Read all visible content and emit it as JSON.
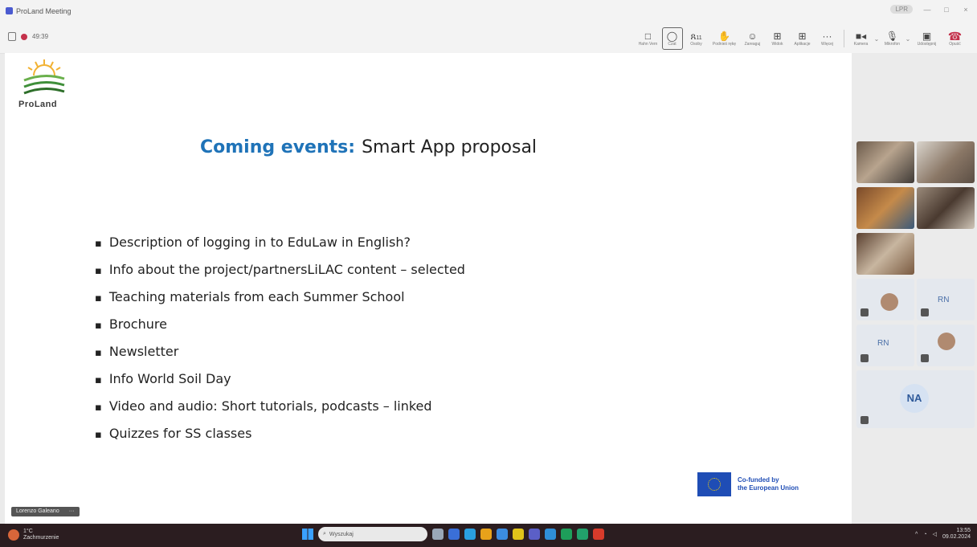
{
  "window": {
    "title": "ProLand Meeting",
    "controls": {
      "pill": "LPR",
      "minimize": "—",
      "maximize": "□",
      "close": "×"
    }
  },
  "meeting": {
    "timer": "49:39"
  },
  "toolbar": {
    "items": [
      {
        "name": "raise-item",
        "icon": "□",
        "label": "Hahn Vern"
      },
      {
        "name": "chat",
        "icon": "◯",
        "label": "Czat"
      },
      {
        "name": "people",
        "icon": "ጸ",
        "label": "Osoby"
      },
      {
        "name": "raise-hand",
        "icon": "✋",
        "label": "Podnieś rękę"
      },
      {
        "name": "react",
        "icon": "☺",
        "label": "Zareaguj"
      },
      {
        "name": "view",
        "icon": "⊞",
        "label": "Widok"
      },
      {
        "name": "apps",
        "icon": "⊞",
        "label": "Aplikacje"
      },
      {
        "name": "more",
        "icon": "···",
        "label": "Więcej"
      }
    ],
    "people_count": "11",
    "camera_label": "Kamera",
    "mic_label": "Mikrofon",
    "share_label": "Udostępnij",
    "leave_label": "Opuść"
  },
  "slide": {
    "logo_text": "ProLand",
    "title_highlight": "Coming events:",
    "title_rest": "Smart App proposal",
    "bullets": [
      "Description of logging in to EduLaw in English?",
      "Info about the project/partnersLiLAC content – selected",
      "Teaching materials from each Summer School",
      "Brochure",
      "Newsletter",
      "Info World Soil Day",
      "Video and audio: Short tutorials, podcasts – linked",
      "Quizzes for SS classes"
    ],
    "eu_line1": "Co-funded by",
    "eu_line2": "the European Union"
  },
  "presenter": {
    "name": "Lorenzo Galeano",
    "more": "···"
  },
  "participants": {
    "rn1": "RN",
    "rn2": "RN",
    "na": "NA"
  },
  "taskbar": {
    "weather_temp": "1°C",
    "weather_desc": "Zachmurzenie",
    "search_placeholder": "Wyszukaj",
    "time": "13:55",
    "date": "09.02.2024",
    "tray_chevron": "^"
  },
  "colors": {
    "accent_blue": "#1f73b8",
    "leave_red": "#c4314b",
    "eu_blue": "#1f4db5",
    "taskbar": "#2b1d20"
  }
}
